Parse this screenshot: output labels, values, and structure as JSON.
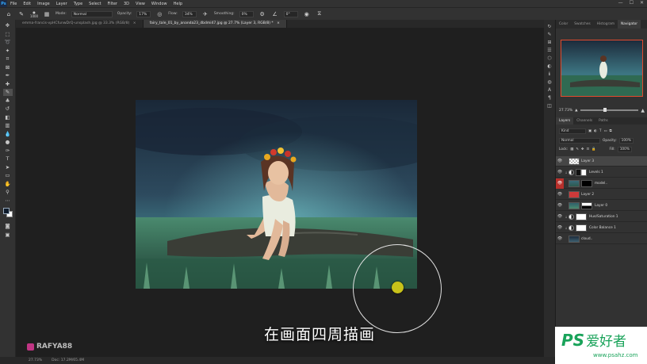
{
  "menubar": {
    "logo": "Ps",
    "items": [
      "File",
      "Edit",
      "Image",
      "Layer",
      "Type",
      "Select",
      "Filter",
      "3D",
      "View",
      "Window",
      "Help"
    ],
    "window_controls": [
      "—",
      "☐",
      "✕"
    ]
  },
  "options": {
    "brush_size": "1000",
    "mode_label": "Mode:",
    "mode_value": "Normal",
    "opacity_label": "Opacity:",
    "opacity_value": "17%",
    "flow_label": "Flow:",
    "flow_value": "34%",
    "smoothing_label": "Smoothing:",
    "smoothing_value": "0%",
    "angle_value": "0°"
  },
  "tabs": [
    {
      "label": "emma-francis-vpHCfunwDrQ-unsplash.jpg @ 33.3% (RGB/8)",
      "close": "×",
      "active": false
    },
    {
      "label": "fairy_tale_01_by_ananda23_dbdmi47.jpg @ 27.7% (Layer 3, RGB/8) *",
      "close": "×",
      "active": true
    }
  ],
  "tools": [
    "move",
    "marquee",
    "lasso",
    "quick-select",
    "crop",
    "frame",
    "eyedropper",
    "healing",
    "brush",
    "clone-stamp",
    "history-brush",
    "eraser",
    "gradient",
    "blur",
    "dodge",
    "pen",
    "type",
    "path-select",
    "rectangle",
    "hand",
    "zoom",
    "more"
  ],
  "colors": {
    "foreground": "#0e1b2b",
    "background": "#ffffff",
    "brush_dot": "#c8c21a",
    "selected_visibility": "#b8302b",
    "watermark_green": "#19a35a"
  },
  "canvas": {
    "subtitle": "在画面四周描画",
    "brand": "RAFYA88"
  },
  "status": {
    "zoom": "27.73%",
    "doc": "Doc: 17.2M/65.4M"
  },
  "panel": {
    "top_tabs": [
      "Color",
      "Swatches",
      "Histogram",
      "Navigator"
    ],
    "active_top_tab": "Navigator",
    "nav_zoom": "27.73%",
    "layer_tabs": [
      "Layers",
      "Channels",
      "Paths"
    ],
    "kind_label": "Kind",
    "blend_mode": "Normal",
    "opacity_label": "Opacity:",
    "opacity_value": "100%",
    "lock_label": "Lock:",
    "fill_label": "Fill:",
    "fill_value": "100%"
  },
  "layers": [
    {
      "name": "Layer 3",
      "selected": true,
      "type": "pixel"
    },
    {
      "name": "Levels 1",
      "selected": false,
      "type": "adjustment"
    },
    {
      "name": "model..",
      "selected": false,
      "type": "masked",
      "eye_highlight": true
    },
    {
      "name": "Layer 2",
      "selected": false,
      "type": "pixel"
    },
    {
      "name": "Layer 0",
      "selected": false,
      "type": "masked"
    },
    {
      "name": "Hue/Saturation 1",
      "selected": false,
      "type": "adjustment"
    },
    {
      "name": "Color Balance 1",
      "selected": false,
      "type": "adjustment"
    },
    {
      "name": "cloud..",
      "selected": false,
      "type": "pixel"
    }
  ],
  "watermark": {
    "ps": "PS",
    "cn": "爱好者",
    "url": "www.psahz.com"
  }
}
